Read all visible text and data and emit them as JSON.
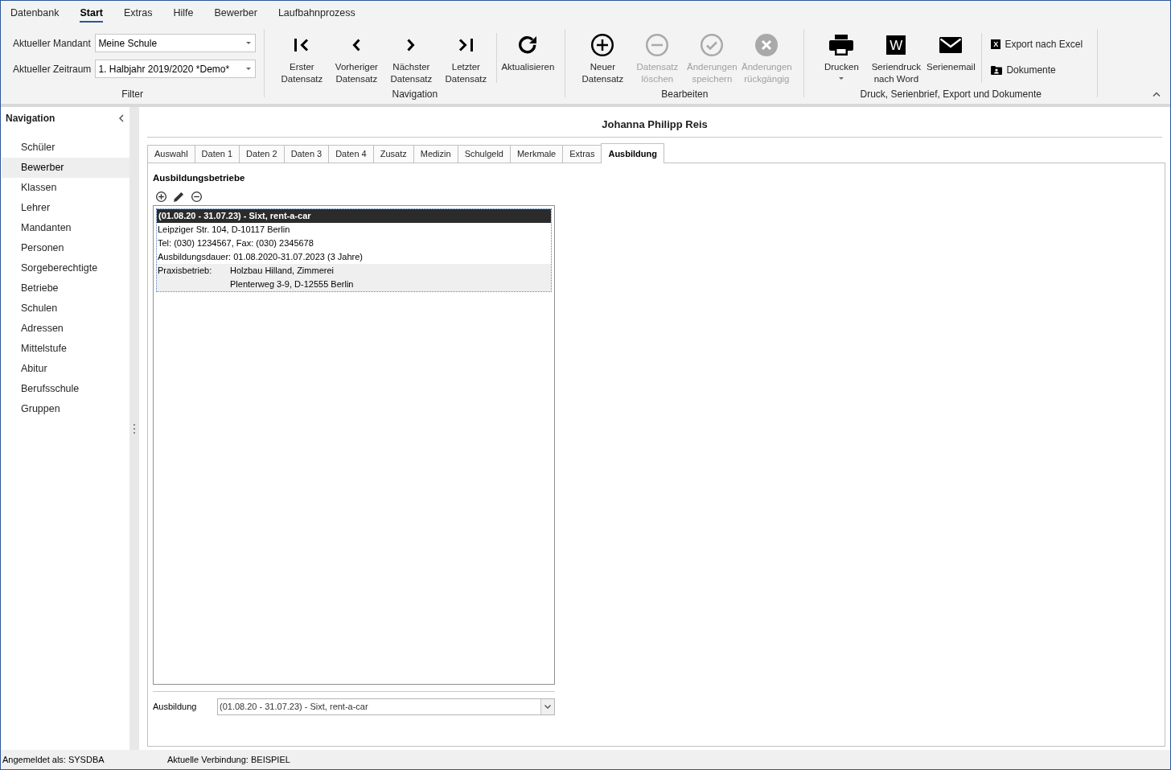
{
  "menu_tabs": [
    {
      "label": "Datenbank",
      "selected": false
    },
    {
      "label": "Start",
      "selected": true
    },
    {
      "label": "Extras",
      "selected": false
    },
    {
      "label": "Hilfe",
      "selected": false
    },
    {
      "label": "Bewerber",
      "selected": false
    },
    {
      "label": "Laufbahnprozess",
      "selected": false
    }
  ],
  "ribbon": {
    "groups": [
      {
        "kind": "filter",
        "title": "Filter",
        "fields": [
          {
            "label": "Aktueller Mandant",
            "value": "Meine Schule"
          },
          {
            "label": "Aktueller Zeitraum",
            "value": "1. Halbjahr 2019/2020 *Demo*"
          }
        ]
      },
      {
        "kind": "buttons",
        "title": "Navigation",
        "sections": [
          {
            "kind": "large",
            "buttons": [
              {
                "kind": "first",
                "label": "Erster Datensatz",
                "disabled": false,
                "dropdown": false
              },
              {
                "kind": "previous",
                "label": "Vorheriger Datensatz",
                "disabled": false,
                "dropdown": false
              },
              {
                "kind": "next",
                "label": "Nächster Datensatz",
                "disabled": false,
                "dropdown": false
              },
              {
                "kind": "last",
                "label": "Letzter Datensatz",
                "disabled": false,
                "dropdown": false
              }
            ]
          },
          {
            "kind": "large",
            "buttons": [
              {
                "kind": "refresh",
                "label": "Aktualisieren",
                "disabled": false,
                "dropdown": false
              }
            ]
          }
        ]
      },
      {
        "kind": "buttons",
        "title": "Bearbeiten",
        "sections": [
          {
            "kind": "large",
            "buttons": [
              {
                "kind": "add",
                "label": "Neuer Datensatz",
                "disabled": false,
                "dropdown": false
              },
              {
                "kind": "delete",
                "label": "Datensatz löschen",
                "disabled": true,
                "dropdown": false
              },
              {
                "kind": "save",
                "label": "Änderungen speichern",
                "disabled": true,
                "dropdown": false
              },
              {
                "kind": "undo",
                "label": "Änderungen rückgängig",
                "disabled": true,
                "dropdown": false
              }
            ]
          }
        ]
      },
      {
        "kind": "buttons",
        "title": "Druck, Serienbrief, Export und Dokumente",
        "sections": [
          {
            "kind": "large",
            "buttons": [
              {
                "kind": "print",
                "label": "Drucken",
                "disabled": false,
                "dropdown": true
              },
              {
                "kind": "word",
                "label": "Seriendruck nach Word",
                "tile": "W",
                "disabled": false,
                "dropdown": false
              },
              {
                "kind": "mail",
                "label": "Serienemail",
                "disabled": false,
                "dropdown": false
              }
            ]
          },
          {
            "kind": "small",
            "buttons": [
              {
                "kind": "excel",
                "label": "Export nach Excel",
                "tile": "X",
                "disabled": false,
                "dropdown": false
              },
              {
                "kind": "documents",
                "label": "Dokumente",
                "disabled": false,
                "dropdown": false
              }
            ]
          }
        ]
      }
    ]
  },
  "sidebar": {
    "title": "Navigation",
    "items": [
      {
        "label": "Schüler",
        "selected": false
      },
      {
        "label": "Bewerber",
        "selected": true
      },
      {
        "label": "Klassen",
        "selected": false
      },
      {
        "label": "Lehrer",
        "selected": false
      },
      {
        "label": "Mandanten",
        "selected": false
      },
      {
        "label": "Personen",
        "selected": false
      },
      {
        "label": "Sorgeberechtigte",
        "selected": false
      },
      {
        "label": "Betriebe",
        "selected": false
      },
      {
        "label": "Schulen",
        "selected": false
      },
      {
        "label": "Adressen",
        "selected": false
      },
      {
        "label": "Mittelstufe",
        "selected": false
      },
      {
        "label": "Abitur",
        "selected": false
      },
      {
        "label": "Berufsschule",
        "selected": false
      },
      {
        "label": "Gruppen",
        "selected": false
      }
    ]
  },
  "record": {
    "title": "Johanna Philipp Reis",
    "tabs": [
      {
        "label": "Auswahl",
        "selected": false
      },
      {
        "label": "Daten 1",
        "selected": false
      },
      {
        "label": "Daten 2",
        "selected": false
      },
      {
        "label": "Daten 3",
        "selected": false
      },
      {
        "label": "Daten 4",
        "selected": false
      },
      {
        "label": "Zusatz",
        "selected": false
      },
      {
        "label": "Medizin",
        "selected": false
      },
      {
        "label": "Schulgeld",
        "selected": false
      },
      {
        "label": "Merkmale",
        "selected": false
      },
      {
        "label": "Extras",
        "selected": false
      },
      {
        "label": "Ausbildung",
        "selected": true
      }
    ],
    "section_title": "Ausbildungsbetriebe",
    "list": {
      "items": [
        {
          "title": "(01.08.20 - 31.07.23) - Sixt, rent-a-car",
          "selected": true,
          "lines": [
            "Leipziger Str. 104, D-10117 Berlin",
            "Tel: (030) 1234567, Fax: (030) 2345678",
            "Ausbildungsdauer: 01.08.2020-31.07.2023 (3 Jahre)"
          ],
          "practice_label": "Praxisbetrieb:",
          "practice_lines": [
            "Holzbau Hilland, Zimmerei",
            "Plenterweg 3-9, D-12555 Berlin"
          ]
        }
      ]
    },
    "ausbildung": {
      "label": "Ausbildung",
      "value": "(01.08.20 - 31.07.23) - Sixt, rent-a-car"
    }
  },
  "status_bar": [
    "Angemeldet als: SYSDBA",
    "Aktuelle Verbindung: BEISPIEL"
  ]
}
